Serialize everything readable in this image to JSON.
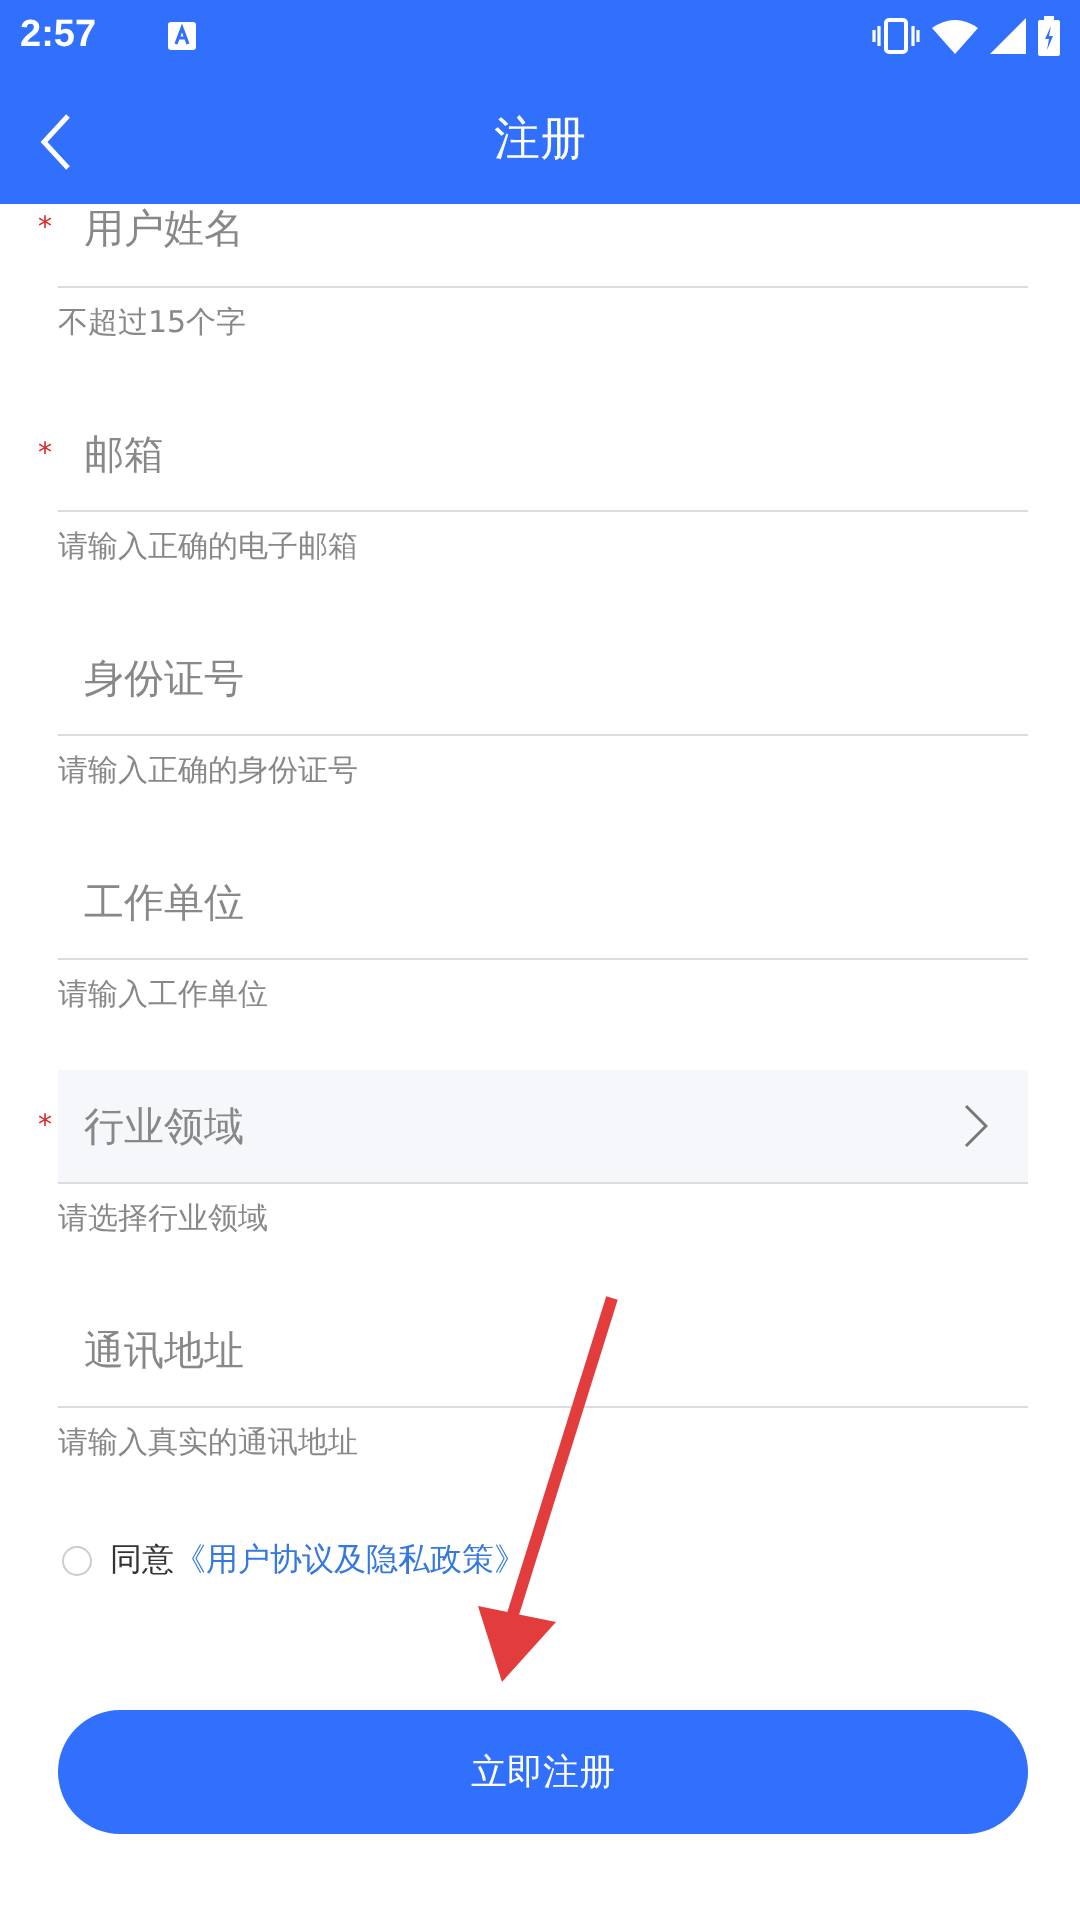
{
  "status_bar": {
    "time": "2:57"
  },
  "header": {
    "title": "注册"
  },
  "fields": [
    {
      "kind": "text",
      "required_mark": "*",
      "placeholder": "用户姓名",
      "hint": "不超过15个字"
    },
    {
      "kind": "text",
      "required_mark": "*",
      "placeholder": "邮箱",
      "hint": "请输入正确的电子邮箱"
    },
    {
      "kind": "text",
      "placeholder": "身份证号",
      "hint": "请输入正确的身份证号"
    },
    {
      "kind": "text",
      "placeholder": "工作单位",
      "hint": "请输入工作单位"
    },
    {
      "kind": "select",
      "required_mark": "*",
      "placeholder": "行业领域",
      "hint": "请选择行业领域"
    },
    {
      "kind": "text",
      "placeholder": "通讯地址",
      "hint": "请输入真实的通讯地址"
    }
  ],
  "agreement": {
    "checked": false,
    "text": "同意",
    "link": "《用户协议及隐私政策》"
  },
  "submit": "立即注册"
}
